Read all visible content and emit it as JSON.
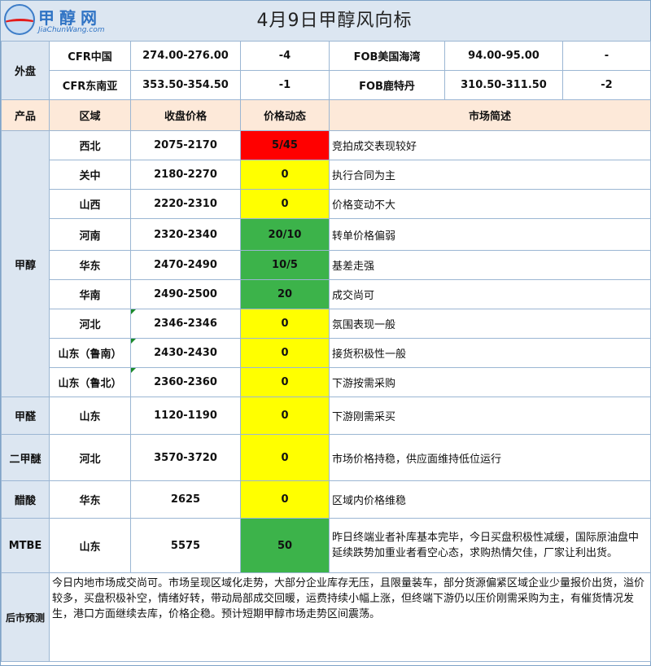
{
  "logo": {
    "name": "甲醇网",
    "url": "JiaChunWang.com"
  },
  "title": "4月9日甲醇风向标",
  "external": {
    "label": "外盘",
    "rows": [
      {
        "a_name": "CFR中国",
        "a_price": "274.00-276.00",
        "a_change": "-4",
        "b_name": "FOB美国海湾",
        "b_price": "94.00-95.00",
        "b_change": "-"
      },
      {
        "a_name": "CFR东南亚",
        "a_price": "353.50-354.50",
        "a_change": "-1",
        "b_name": "FOB鹿特丹",
        "b_price": "310.50-311.50",
        "b_change": "-2"
      }
    ]
  },
  "table_header": {
    "product": "产品",
    "region": "区域",
    "price": "收盘价格",
    "change": "价格动态",
    "summary": "市场简述"
  },
  "products": [
    {
      "product": "甲醇",
      "rows": [
        {
          "region": "西北",
          "price": "2075-2170",
          "change": "5/45",
          "color": "red",
          "summary": "竞拍成交表现较好"
        },
        {
          "region": "关中",
          "price": "2180-2270",
          "change": "0",
          "color": "yellow",
          "summary": "执行合同为主"
        },
        {
          "region": "山西",
          "price": "2220-2310",
          "change": "0",
          "color": "yellow",
          "summary": "价格变动不大"
        },
        {
          "region": "河南",
          "price": "2320-2340",
          "change": "20/10",
          "color": "green",
          "summary": "转单价格偏弱"
        },
        {
          "region": "华东",
          "price": "2470-2490",
          "change": "10/5",
          "color": "green",
          "summary": "基差走强"
        },
        {
          "region": "华南",
          "price": "2490-2500",
          "change": "20",
          "color": "green",
          "summary": "成交尚可"
        },
        {
          "region": "河北",
          "price": "2346-2346",
          "change": "0",
          "color": "yellow",
          "summary": "氛围表现一般"
        },
        {
          "region": "山东（鲁南）",
          "price": "2430-2430",
          "change": "0",
          "color": "yellow",
          "summary": "接货积极性一般"
        },
        {
          "region": "山东（鲁北）",
          "price": "2360-2360",
          "change": "0",
          "color": "yellow",
          "summary": "下游按需采购"
        }
      ]
    },
    {
      "product": "甲醛",
      "rows": [
        {
          "region": "山东",
          "price": "1120-1190",
          "change": "0",
          "color": "yellow",
          "summary": "下游刚需采买"
        }
      ]
    },
    {
      "product": "二甲醚",
      "rows": [
        {
          "region": "河北",
          "price": "3570-3720",
          "change": "0",
          "color": "yellow",
          "summary": "市场价格持稳，供应面维持低位运行"
        }
      ]
    },
    {
      "product": "醋酸",
      "rows": [
        {
          "region": "华东",
          "price": "2625",
          "change": "0",
          "color": "yellow",
          "summary": "区域内价格维稳"
        }
      ]
    },
    {
      "product": "MTBE",
      "rows": [
        {
          "region": "山东",
          "price": "5575",
          "change": "50",
          "color": "green",
          "summary": "昨日终端业者补库基本完毕，今日买盘积极性减缓，国际原油盘中延续跌势加重业者看空心态，求购热情欠佳，厂家让利出货。"
        }
      ]
    }
  ],
  "forecast": {
    "label": "后市预测",
    "text": "今日内地市场成交尚可。市场呈现区域化走势，大部分企业库存无压，且限量装车，部分货源偏紧区域企业少量报价出货，溢价较多，买盘积极补空，情绪好转，带动局部成交回暖，运费持续小幅上涨，但终端下游仍以压价刚需采购为主，有催货情况发生，港口方面继续去库，价格企稳。预计短期甲醇市场走势区间震荡。"
  },
  "colors": {
    "red": "#ff0000",
    "yellow": "#ffff00",
    "green": "#3cb34a",
    "label_bg": "#dce6f1",
    "header_bg": "#fde9d9"
  }
}
